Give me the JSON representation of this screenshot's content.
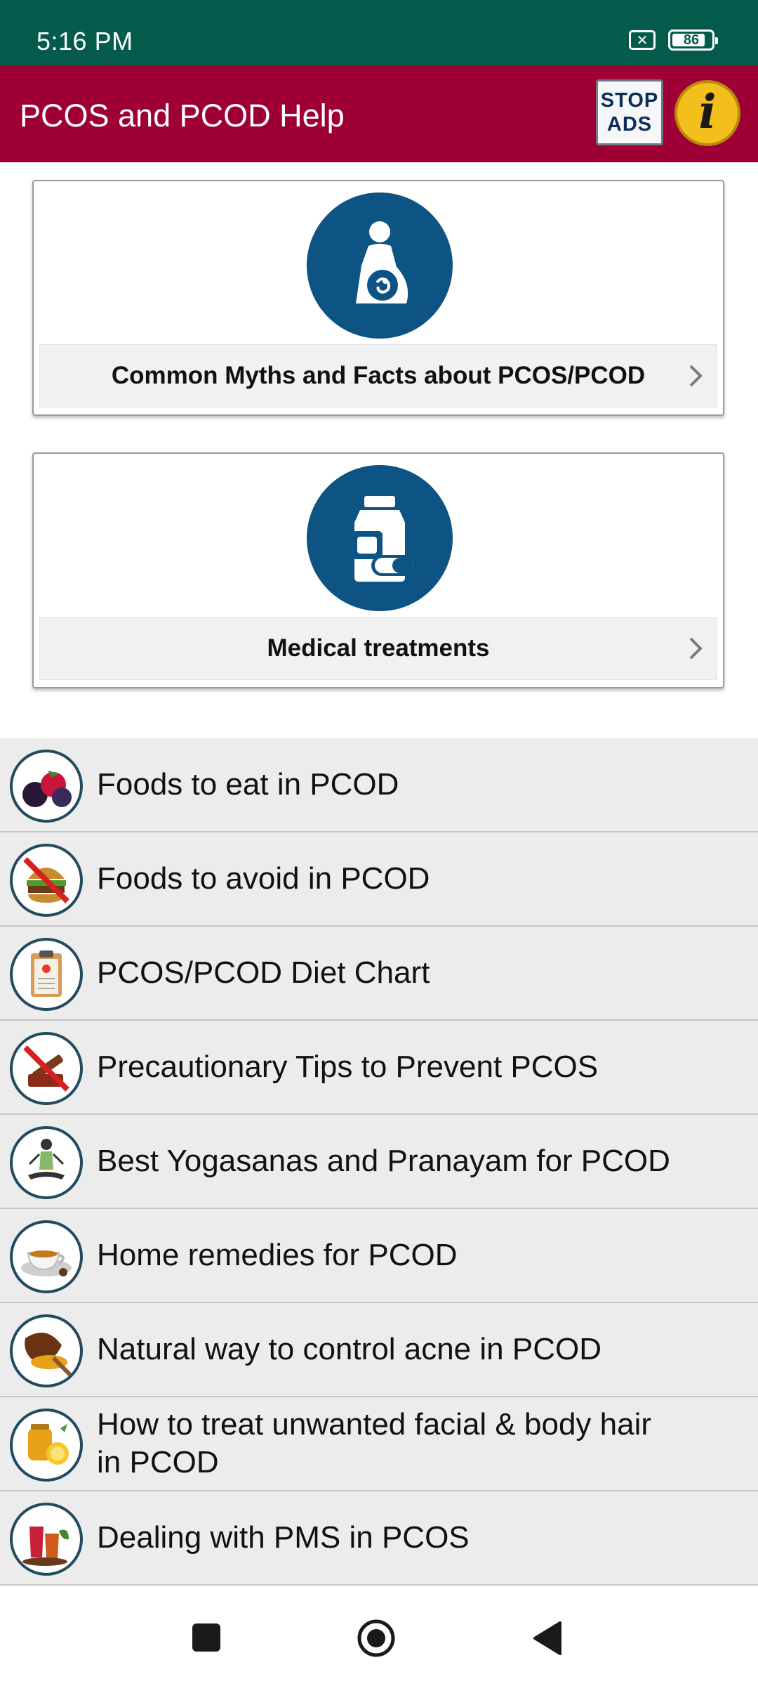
{
  "status_bar": {
    "time": "5:16 PM",
    "notification_icon": "close-box-icon",
    "battery_level": "86",
    "battery_fraction": 0.86
  },
  "app_bar": {
    "title": "PCOS and PCOD Help",
    "stop_ads_line1": "STOP",
    "stop_ads_line2": "ADS",
    "info_icon": "info-icon",
    "background_color": "#9e0035"
  },
  "cards": [
    {
      "label": "Common Myths and Facts about PCOS/PCOD",
      "icon": "pregnant-woman-icon"
    },
    {
      "label": "Medical treatments",
      "icon": "medicine-bottle-pill-icon"
    }
  ],
  "list_items": [
    {
      "label": "Foods to eat in PCOD",
      "icon": "berries-icon"
    },
    {
      "label": "Foods to avoid in PCOD",
      "icon": "no-burger-icon"
    },
    {
      "label": "PCOS/PCOD Diet Chart",
      "icon": "clipboard-icon"
    },
    {
      "label": "Precautionary Tips to Prevent PCOS",
      "icon": "no-smoking-icon"
    },
    {
      "label": "Best Yogasanas and Pranayam for PCOD",
      "icon": "yoga-pose-icon"
    },
    {
      "label": "Home remedies for PCOD",
      "icon": "tea-cup-icon"
    },
    {
      "label": "Natural way to control acne in PCOD",
      "icon": "turmeric-bowl-icon"
    },
    {
      "label": "How to treat unwanted facial & body hair in PCOD",
      "icon": "honey-lemon-icon"
    },
    {
      "label": "Dealing with PMS in PCOS",
      "icon": "herbal-juice-icon"
    }
  ],
  "nav_bar": {
    "recents_icon": "square-recents-icon",
    "home_icon": "circle-home-icon",
    "back_icon": "triangle-back-icon"
  },
  "colors": {
    "status_bar": "#045b4c",
    "accent_blue": "#0d5383",
    "list_background": "#ececec"
  }
}
